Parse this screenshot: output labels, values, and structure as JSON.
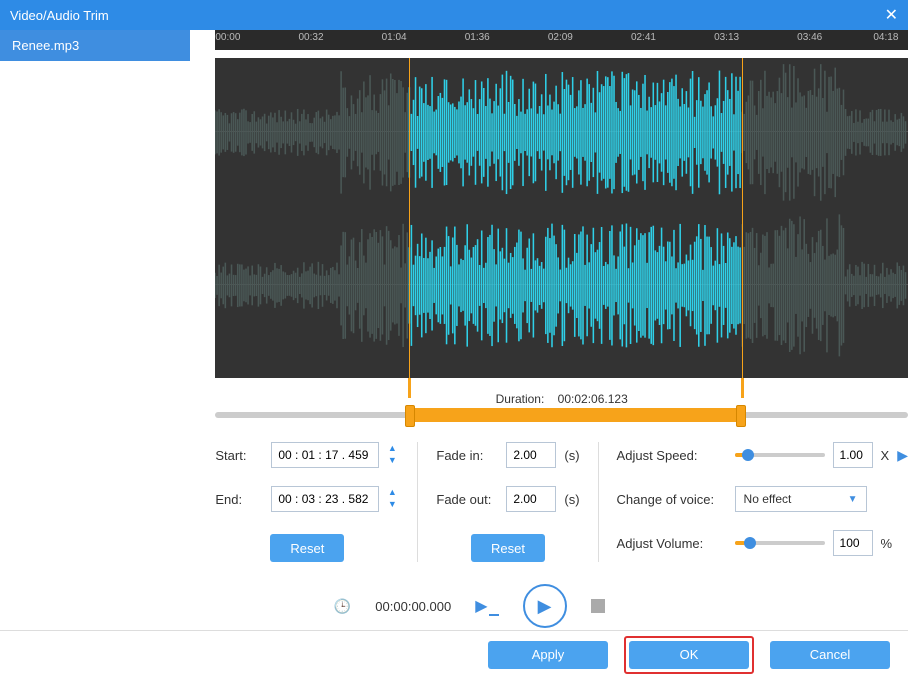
{
  "title": "Video/Audio Trim",
  "sidebar": {
    "items": [
      {
        "label": "Renee.mp3"
      }
    ]
  },
  "ruler": [
    "00:00",
    "00:32",
    "01:04",
    "01:36",
    "02:09",
    "02:41",
    "03:13",
    "03:46",
    "04:18"
  ],
  "selection": {
    "start_pct": 28,
    "end_pct": 76
  },
  "duration": {
    "label": "Duration:",
    "value": "00:02:06.123"
  },
  "start": {
    "label": "Start:",
    "value": "00 : 01 : 17 . 459"
  },
  "end": {
    "label": "End:",
    "value": "00 : 03 : 23 . 582"
  },
  "fade_in": {
    "label": "Fade in:",
    "value": "2.00",
    "unit": "(s)"
  },
  "fade_out": {
    "label": "Fade out:",
    "value": "2.00",
    "unit": "(s)"
  },
  "reset": "Reset",
  "speed": {
    "label": "Adjust Speed:",
    "value": "1.00",
    "suffix": "X"
  },
  "voice": {
    "label": "Change of voice:",
    "value": "No effect"
  },
  "volume": {
    "label": "Adjust Volume:",
    "value": "100",
    "suffix": "%"
  },
  "playbar": {
    "time": "00:00:00.000"
  },
  "footer": {
    "apply": "Apply",
    "ok": "OK",
    "cancel": "Cancel"
  }
}
